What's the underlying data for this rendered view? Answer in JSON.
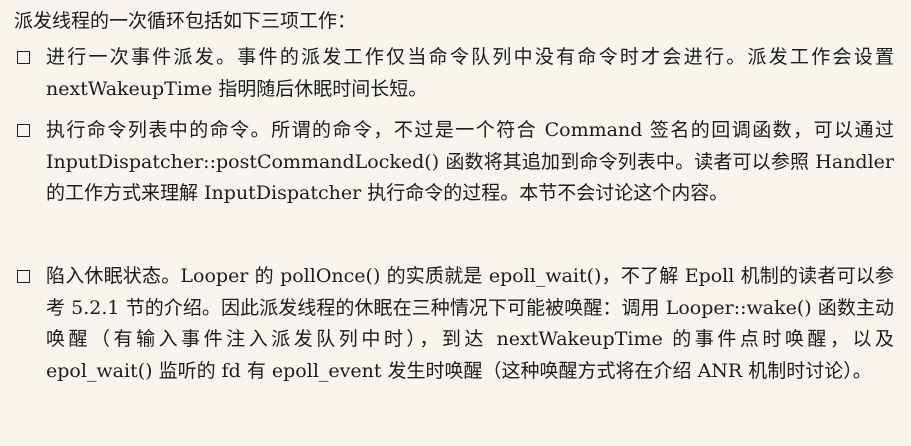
{
  "intro": "派发线程的一次循环包括如下三项工作：",
  "items": [
    {
      "marker": "checkbox",
      "text": "进行一次事件派发。事件的派发工作仅当命令队列中没有命令时才会进行。派发工作会设置 nextWakeupTime 指明随后休眠时间长短。"
    },
    {
      "marker": "checkbox",
      "text": "执行命令列表中的命令。所谓的命令，不过是一个符合 Command 签名的回调函数，可以通过 InputDispatcher::postCommandLocked() 函数将其追加到命令列表中。读者可以参照 Handler 的工作方式来理解 InputDispatcher 执行命令的过程。本节不会讨论这个内容。"
    },
    {
      "marker": "checkbox",
      "text": "陷入休眠状态。Looper 的 pollOnce() 的实质就是 epoll_wait()，不了解 Epoll 机制的读者可以参考 5.2.1 节的介绍。因此派发线程的休眠在三种情况下可能被唤醒：调用 Looper::wake() 函数主动唤醒（有输入事件注入派发队列中时），到达 nextWakeupTime 的事件点时唤醒，以及 epol_wait() 监听的 fd 有 epoll_event 发生时唤醒（这种唤醒方式将在介绍 ANR 机制时讨论）。"
    }
  ],
  "colors": {
    "background": "#f7f5ee",
    "text": "#1c1c1c"
  }
}
